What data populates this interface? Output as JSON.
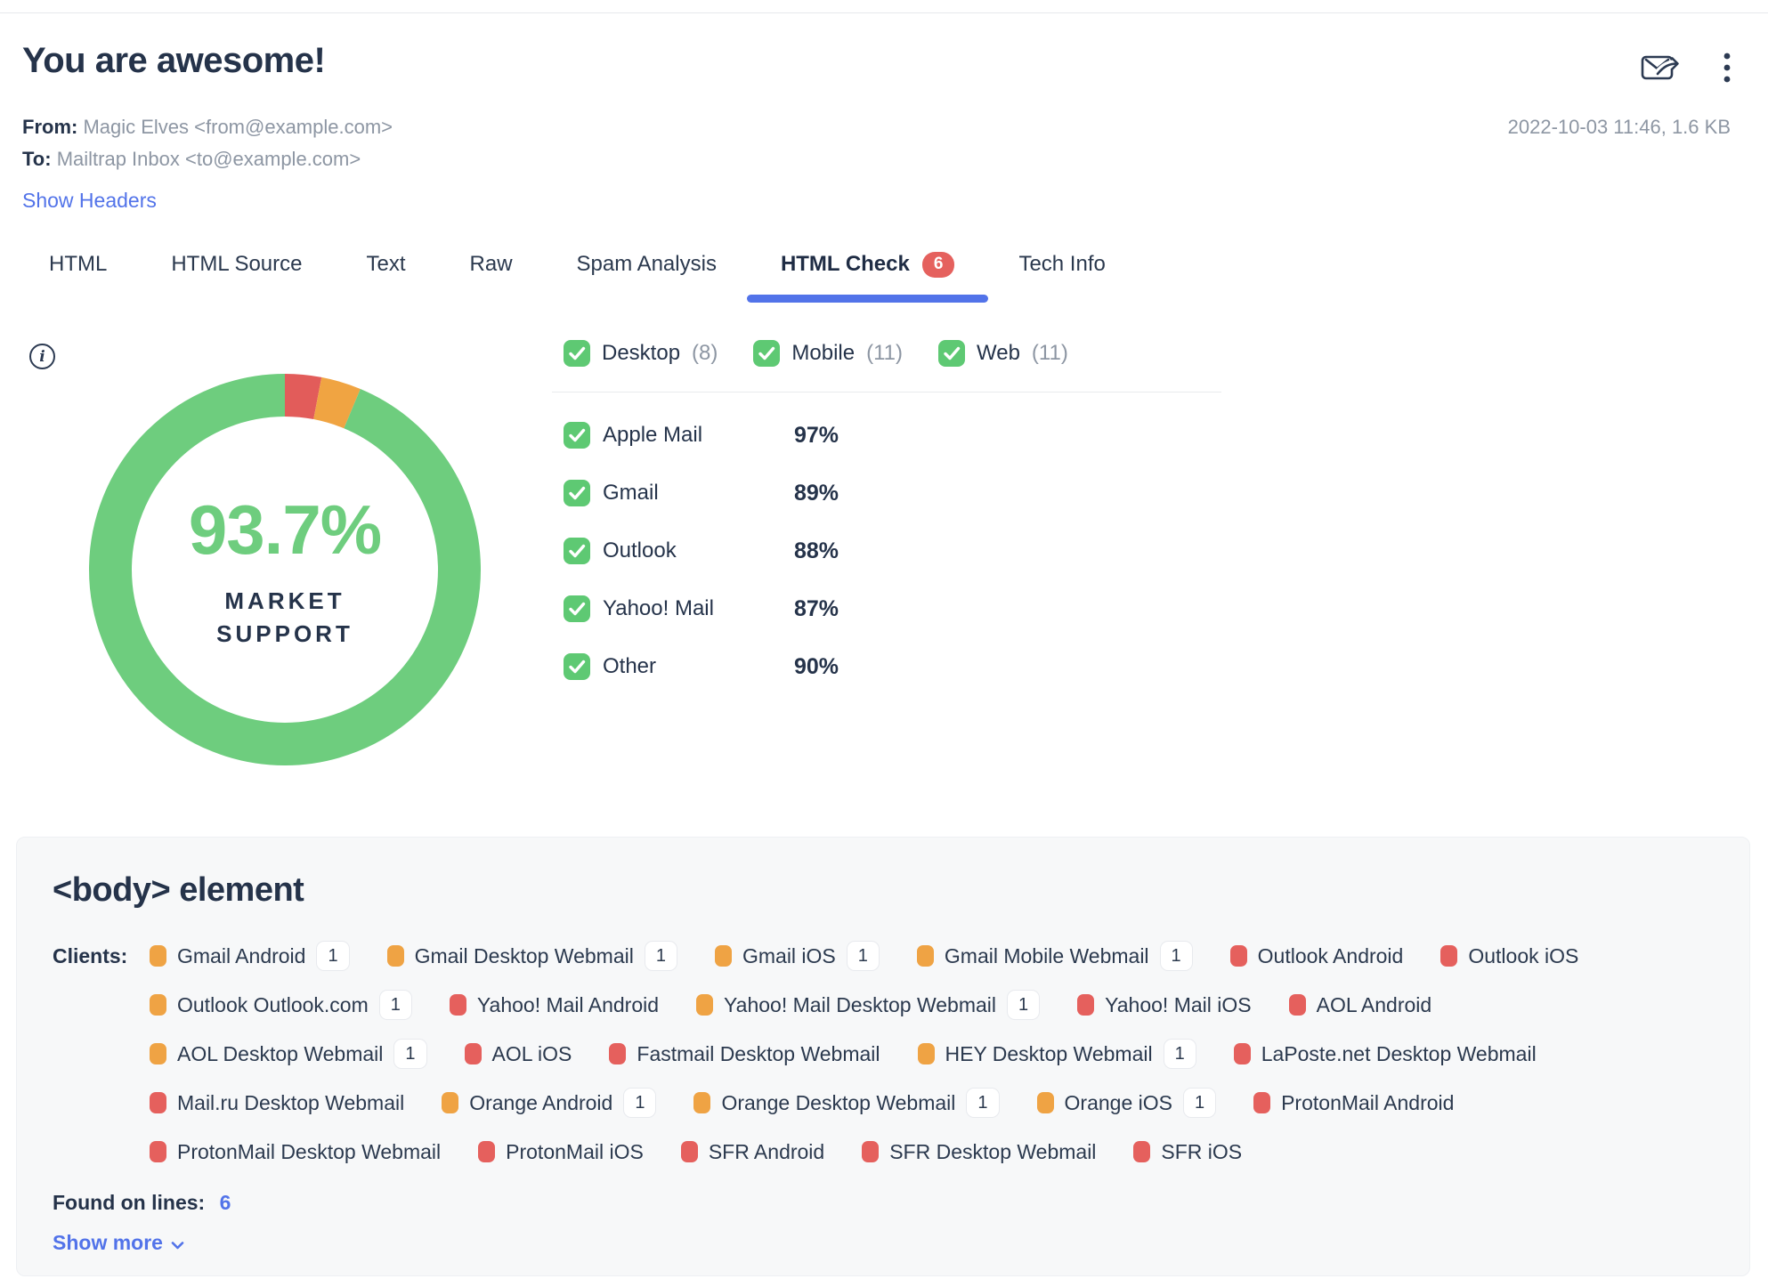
{
  "header": {
    "title": "You are awesome!",
    "from_label": "From:",
    "from_value": "Magic Elves <from@example.com>",
    "to_label": "To:",
    "to_value": "Mailtrap Inbox <to@example.com>",
    "show_headers_label": "Show Headers",
    "meta": "2022-10-03 11:46, 1.6 KB"
  },
  "tabs": [
    {
      "label": "HTML"
    },
    {
      "label": "HTML Source"
    },
    {
      "label": "Text"
    },
    {
      "label": "Raw"
    },
    {
      "label": "Spam Analysis"
    },
    {
      "label": "HTML Check",
      "badge": "6",
      "state": "active"
    },
    {
      "label": "Tech Info"
    }
  ],
  "html_check": {
    "filters": [
      {
        "label": "Desktop",
        "count": "(8)"
      },
      {
        "label": "Mobile",
        "count": "(11)"
      },
      {
        "label": "Web",
        "count": "(11)"
      }
    ],
    "support_rows": [
      {
        "label": "Apple Mail",
        "percent": "97%"
      },
      {
        "label": "Gmail",
        "percent": "89%"
      },
      {
        "label": "Outlook",
        "percent": "88%"
      },
      {
        "label": "Yahoo! Mail",
        "percent": "87%"
      },
      {
        "label": "Other",
        "percent": "90%"
      }
    ]
  },
  "chart_data": {
    "type": "pie",
    "title": "Market support donut",
    "center_value": "93.7%",
    "caption_line1": "MARKET",
    "caption_line2": "SUPPORT",
    "segments": [
      {
        "name": "unsupported",
        "value": 3.0,
        "color": "#e25c5a"
      },
      {
        "name": "partial",
        "value": 3.3,
        "color": "#f0a442"
      },
      {
        "name": "supported",
        "value": 93.7,
        "color": "#6ecd7e"
      }
    ],
    "start_angle_deg": -90
  },
  "issue_card": {
    "title": "<body> element",
    "clients_label": "Clients:",
    "clients": [
      {
        "name": "Gmail Android",
        "level": "partial",
        "count": "1"
      },
      {
        "name": "Gmail Desktop Webmail",
        "level": "partial",
        "count": "1"
      },
      {
        "name": "Gmail iOS",
        "level": "partial",
        "count": "1"
      },
      {
        "name": "Gmail Mobile Webmail",
        "level": "partial",
        "count": "1"
      },
      {
        "name": "Outlook Android",
        "level": "unsupported"
      },
      {
        "name": "Outlook iOS",
        "level": "unsupported"
      },
      {
        "name": "Outlook Outlook.com",
        "level": "partial",
        "count": "1"
      },
      {
        "name": "Yahoo! Mail Android",
        "level": "unsupported"
      },
      {
        "name": "Yahoo! Mail Desktop Webmail",
        "level": "partial",
        "count": "1"
      },
      {
        "name": "Yahoo! Mail iOS",
        "level": "unsupported"
      },
      {
        "name": "AOL Android",
        "level": "unsupported"
      },
      {
        "name": "AOL Desktop Webmail",
        "level": "partial",
        "count": "1"
      },
      {
        "name": "AOL iOS",
        "level": "unsupported"
      },
      {
        "name": "Fastmail Desktop Webmail",
        "level": "unsupported"
      },
      {
        "name": "HEY Desktop Webmail",
        "level": "partial",
        "count": "1"
      },
      {
        "name": "LaPoste.net Desktop Webmail",
        "level": "unsupported"
      },
      {
        "name": "Mail.ru Desktop Webmail",
        "level": "unsupported"
      },
      {
        "name": "Orange Android",
        "level": "partial",
        "count": "1"
      },
      {
        "name": "Orange Desktop Webmail",
        "level": "partial",
        "count": "1"
      },
      {
        "name": "Orange iOS",
        "level": "partial",
        "count": "1"
      },
      {
        "name": "ProtonMail Android",
        "level": "unsupported"
      },
      {
        "name": "ProtonMail Desktop Webmail",
        "level": "unsupported"
      },
      {
        "name": "ProtonMail iOS",
        "level": "unsupported"
      },
      {
        "name": "SFR Android",
        "level": "unsupported"
      },
      {
        "name": "SFR Desktop Webmail",
        "level": "unsupported"
      },
      {
        "name": "SFR iOS",
        "level": "unsupported"
      }
    ],
    "found_on_lines_label": "Found on lines:",
    "found_on_lines_value": "6",
    "show_more_label": "Show more"
  }
}
